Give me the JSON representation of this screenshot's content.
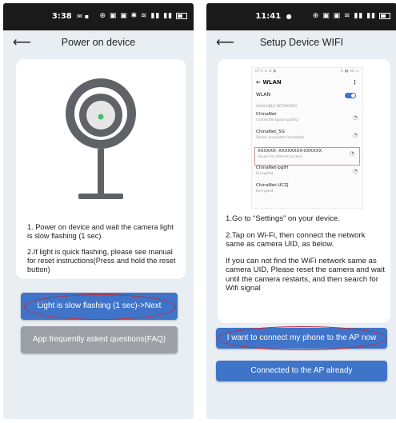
{
  "left": {
    "status_time": "3:38",
    "status_notif": "✉ ▪",
    "status_icons": "⊕ ▣ ▣ ✱ ≋ ▮▮ ▮▮",
    "title": "Power on device",
    "instructions": [
      "1. Power on device and wait the camera light is slow flashing (1 sec).",
      "2.If light is quick flashing, please see manual for reset instructions(Press and hold the reset button)"
    ],
    "primary_button": "Light is slow flashing (1 sec)->Next",
    "faq_button": "App frequently asked questions(FAQ)"
  },
  "right": {
    "status_time": "11:41",
    "status_notif": "●",
    "status_icons": "⊕ ▣ ▣ ≋ ▮▮ ▮▮",
    "title": "Setup Device WIFI",
    "wlan": {
      "status_left": "07:1 ⊖ ⊡ ▣",
      "status_right": "≋ ▮▮ 4G ▭",
      "header": "WLAN",
      "toggle_label": "WLAN",
      "section_label": "AVAILABLE NETWORKS",
      "networks": [
        {
          "name": "ChinaNet",
          "sub": "Connected (good quality)"
        },
        {
          "name": "ChinaNet_5G",
          "sub": "Saved, encrypted (available)"
        },
        {
          "name": "XXXXXX- XXXXXXXX-XXXXXX",
          "sub": "Saved (no Internet access)"
        },
        {
          "name": "ChinaNet-pqlH",
          "sub": "Encrypted"
        },
        {
          "name": "ChinaNet-UCZJ",
          "sub": "Encrypted"
        }
      ]
    },
    "instructions": [
      "1.Go to “Settings” on your device.",
      "2.Tap on Wi-Fi, then connect the network same as camera UID, as below.",
      "If you can not find the WiFi network same as camera UID, Please reset the camera and wait until the camera restarts, and then search for Wifi signal"
    ],
    "primary_button": "I want to connect my phone to the AP now",
    "secondary_button": "Connected to the AP already"
  },
  "colors": {
    "accent_blue": "#3f74c8",
    "gray_button": "#9ca0a6",
    "highlight_oval": "#c4293a",
    "screen_bg": "#e9eef3"
  }
}
